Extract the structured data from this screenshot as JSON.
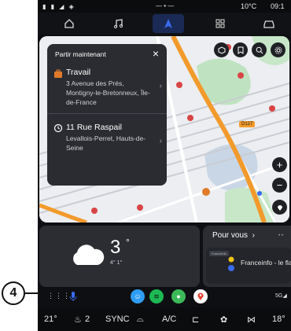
{
  "status_bar": {
    "temperature": "10°C",
    "time": "09:1"
  },
  "nav": {
    "items": [
      "home",
      "music",
      "navigation",
      "apps",
      "car"
    ],
    "active": "navigation"
  },
  "map_card": {
    "header": "Partir maintenant",
    "destinations": [
      {
        "title": "Travail",
        "subtitle": "3 Avenue des Prés, Montigny-le-Bretonneux, Île-de-France",
        "icon": "briefcase-icon"
      },
      {
        "title": "11 Rue Raspail",
        "subtitle": "Levallois-Perret, Hauts-de-Seine",
        "icon": "history-icon"
      }
    ]
  },
  "map": {
    "route_shield": "D127",
    "route_color": "#f29a2b"
  },
  "weather": {
    "temp": "3",
    "unit": "°",
    "range": "4° 1°"
  },
  "for_you": {
    "title": "Pour vous",
    "item_tag": "Franceinfo",
    "item_label": "Franceinfo - le flash eco"
  },
  "callout": {
    "number": "4"
  },
  "climate": {
    "left_temp": "21°",
    "seat_level": "2",
    "sync_label": "SYNC",
    "ac_label": "A/C",
    "right_temp": "18°"
  },
  "colors": {
    "accent": "#3a6bf0",
    "panel": "#2b2d33",
    "background": "#0e0f12"
  }
}
